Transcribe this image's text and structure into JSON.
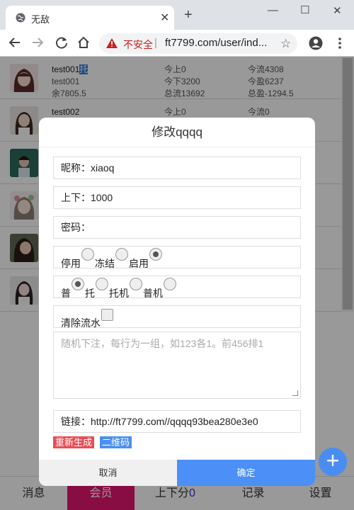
{
  "browser": {
    "tab_title": "无敌",
    "insecure_label": "不安全",
    "separator": "|",
    "url": "ft7799.com/user/ind..."
  },
  "users": [
    {
      "name": "test001",
      "name_selected": "托",
      "line2": "test001",
      "line3": "余7805.5",
      "c2l1": "今上0",
      "c2l2": "今下3200",
      "c2l3": "总流13692",
      "c3l1": "今流4308",
      "c3l2": "今盈6237",
      "c3l3": "总盈-1294.5"
    },
    {
      "name": "test002",
      "c2l1": "今上0",
      "c3l1": "今流0"
    }
  ],
  "dialog": {
    "title": "修改qqqq",
    "nickname_label": "昵称：",
    "nickname_value": "xiaoq",
    "updown_label": "上下：",
    "updown_value": "1000",
    "password_label": "密码：",
    "status_options": [
      "停用",
      "冻结",
      "启用"
    ],
    "status_selected": 2,
    "type_options": [
      "普",
      "托",
      "托机",
      "普机"
    ],
    "type_selected": 0,
    "clear_label": "清除流水",
    "clear_checked": false,
    "textarea_placeholder": "随机下注，每行为一组，如123各1。前456排1",
    "link_label": "链接：",
    "link_value": "http://ft7799.com//qqqq93bea280e3e0",
    "regen_label": "重新生成",
    "qrcode_label": "二维码",
    "cancel_label": "取消",
    "confirm_label": "确定"
  },
  "bottom_nav": {
    "items": [
      "消息",
      "会员",
      "上下分",
      "记录",
      "设置"
    ],
    "updown_count": "0",
    "active_index": 1
  },
  "colors": {
    "accent_blue": "#4b8ff7",
    "active_tab": "#e3176f",
    "regen_red": "#e84e54"
  }
}
